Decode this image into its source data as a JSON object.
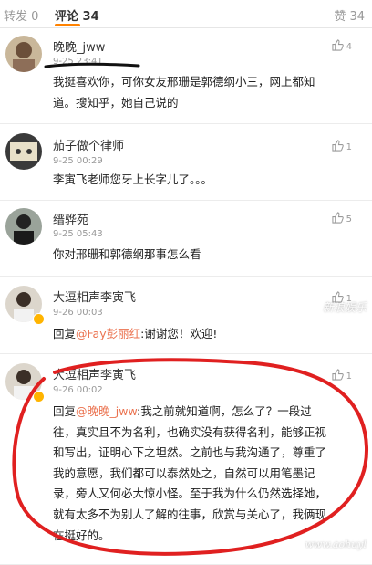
{
  "tabs": {
    "repost": "转发 0",
    "comment": "评论 34",
    "like": "赞 34"
  },
  "comments": [
    {
      "name": "晚晚_jww",
      "time": "9-25 23:41",
      "likes": "4",
      "text": "我挺喜欢你，可你女友邢珊是郭德纲小三，网上都知道。搜知乎，她自己说的"
    },
    {
      "name": "茄子做个律师",
      "time": "9-25 00:29",
      "likes": "1",
      "text": "李寅飞老师您牙上长字儿了。。。"
    },
    {
      "name": "缙骅苑",
      "time": "9-25 05:43",
      "likes": "5",
      "text": "你对邢珊和郭德纲那事怎么看"
    },
    {
      "name": "大逗相声李寅飞",
      "time": "9-26 00:03",
      "likes": "1",
      "reply_prefix": "回复",
      "mention": "@Fay彭丽红",
      "text": ":谢谢您！欢迎!"
    },
    {
      "name": "大逗相声李寅飞",
      "time": "9-26 00:02",
      "likes": "1",
      "reply_prefix": "回复",
      "mention": "@晚晚_jww",
      "text": ":我之前就知道啊，怎么了？一段过往，真实且不为名利，也确实没有获得名利，能够正视和写出，证明心下之坦然。之前也与我沟通了，尊重了我的意愿，我们都可以泰然处之，自然可以用笔墨记录，旁人又何必大惊小怪。至于我为什么仍然选择她，就有太多不为别人了解的往事，欣赏与关心了，我俩现在挺好的。"
    }
  ],
  "watermark": {
    "line1": "新浪娱乐",
    "line2": "www.aohuyl"
  },
  "colors": {
    "accent_orange": "#ff8200",
    "mention": "#eb7350",
    "annotation_red": "#e02020"
  }
}
